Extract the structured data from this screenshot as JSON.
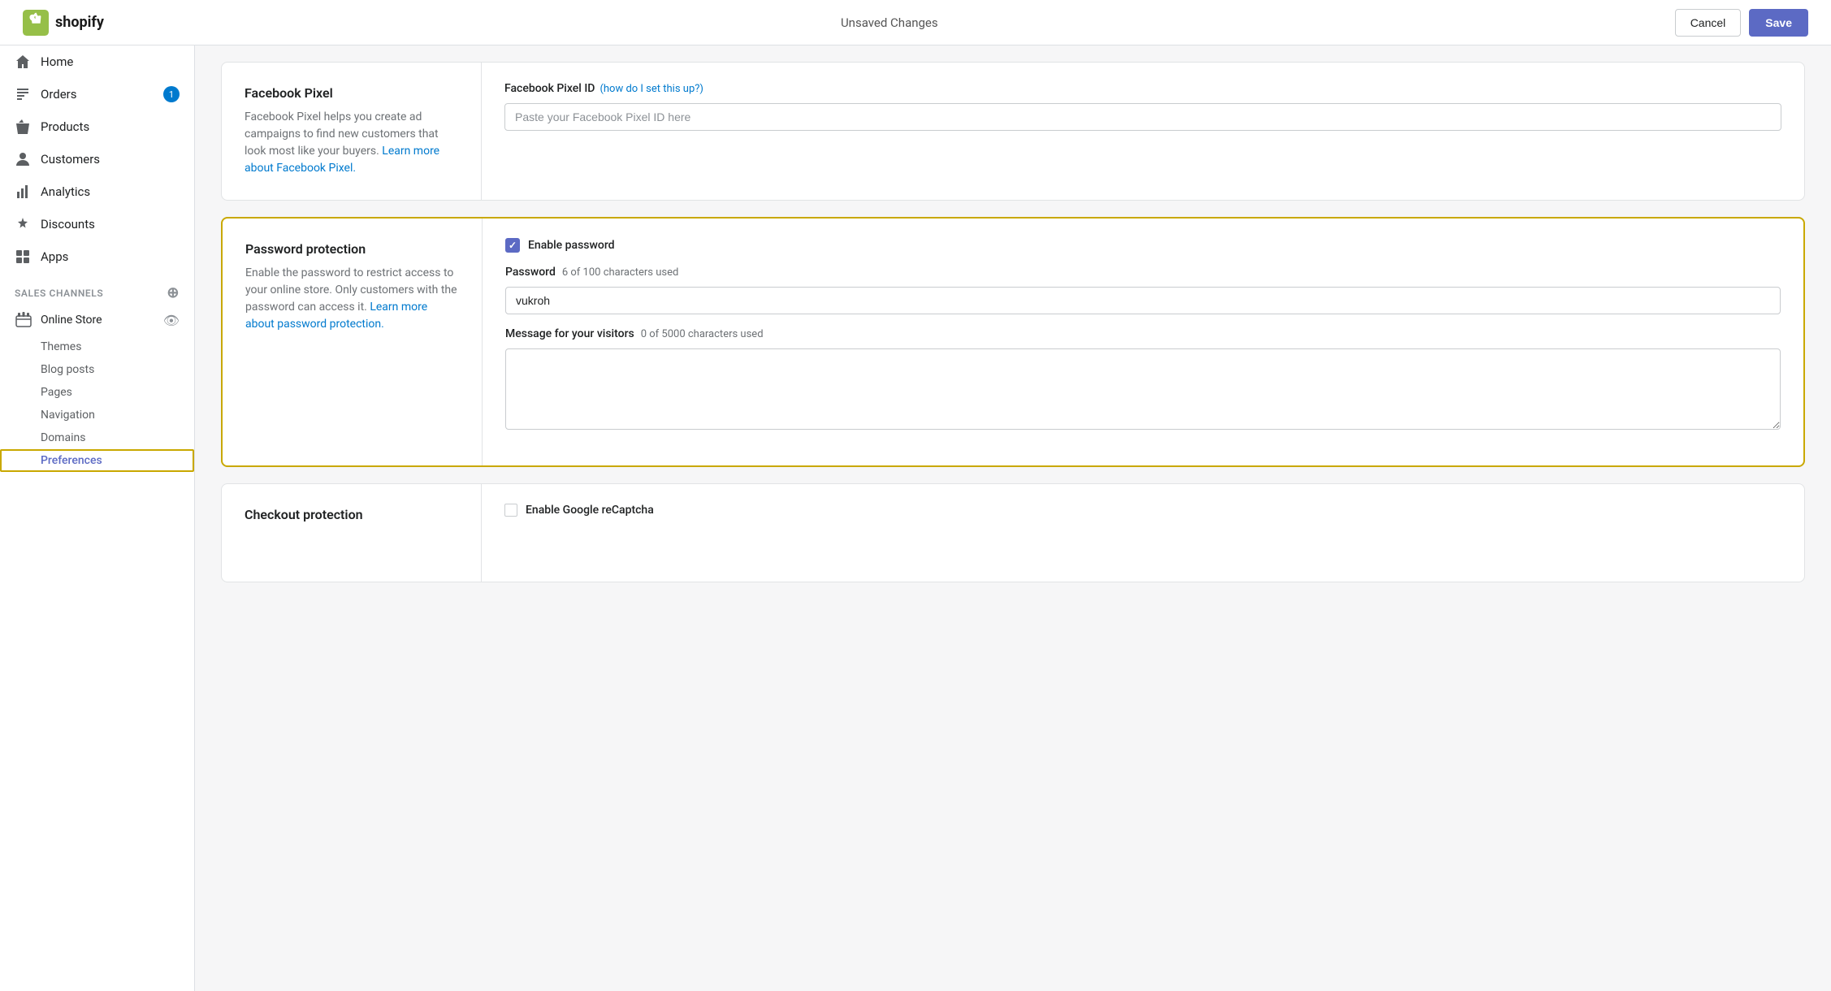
{
  "topbar": {
    "logo_text": "shopify",
    "unsaved_label": "Unsaved Changes",
    "cancel_label": "Cancel",
    "save_label": "Save"
  },
  "sidebar": {
    "nav_items": [
      {
        "id": "home",
        "label": "Home",
        "icon": "home"
      },
      {
        "id": "orders",
        "label": "Orders",
        "icon": "orders",
        "badge": "1"
      },
      {
        "id": "products",
        "label": "Products",
        "icon": "products"
      },
      {
        "id": "customers",
        "label": "Customers",
        "icon": "customers"
      },
      {
        "id": "analytics",
        "label": "Analytics",
        "icon": "analytics"
      },
      {
        "id": "discounts",
        "label": "Discounts",
        "icon": "discounts"
      },
      {
        "id": "apps",
        "label": "Apps",
        "icon": "apps"
      }
    ],
    "sales_channels_label": "SALES CHANNELS",
    "online_store_label": "Online Store",
    "sub_items": [
      {
        "id": "themes",
        "label": "Themes",
        "active": false
      },
      {
        "id": "blog-posts",
        "label": "Blog posts",
        "active": false
      },
      {
        "id": "pages",
        "label": "Pages",
        "active": false
      },
      {
        "id": "navigation",
        "label": "Navigation",
        "active": false
      },
      {
        "id": "domains",
        "label": "Domains",
        "active": false
      },
      {
        "id": "preferences",
        "label": "Preferences",
        "active": true
      }
    ]
  },
  "facebook_pixel": {
    "title": "Facebook Pixel",
    "description_part1": "Facebook Pixel helps you create ad campaigns to find new customers that look most like your buyers.",
    "learn_more_text": "Learn more about Facebook Pixel.",
    "field_label": "Facebook Pixel ID",
    "field_link_text": "(how do I set this up?)",
    "placeholder": "Paste your Facebook Pixel ID here"
  },
  "password_protection": {
    "title": "Password protection",
    "description": "Enable the password to restrict access to your online store. Only customers with the password can access it.",
    "learn_more_text": "Learn more about password protection.",
    "enable_label": "Enable password",
    "enable_checked": true,
    "password_label": "Password",
    "password_chars": "6 of 100 characters used",
    "password_value": "vukroh",
    "message_label": "Message for your visitors",
    "message_chars": "0 of 5000 characters used",
    "message_value": ""
  },
  "checkout_protection": {
    "title": "Checkout protection",
    "enable_recaptcha_label": "Enable Google reCaptcha"
  }
}
